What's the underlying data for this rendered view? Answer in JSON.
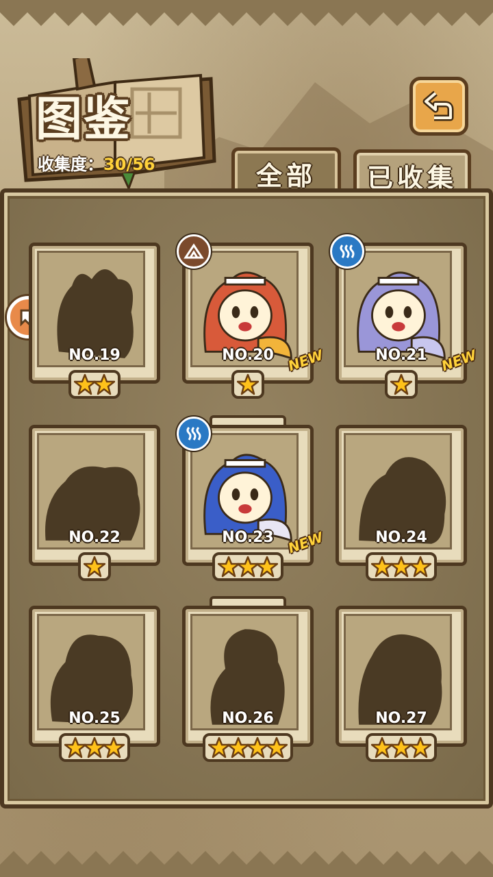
{
  "header": {
    "title": "图鉴",
    "collection_label": "收集度：",
    "collection_value": "30/56"
  },
  "tabs": [
    {
      "label": "全部",
      "active": true
    },
    {
      "label": "已收集",
      "active": false
    }
  ],
  "icons": {
    "back": "back-arrow-icon",
    "prev_page": "left-arrow-icon",
    "star": "star-icon",
    "earth": "mountain-element-icon",
    "water": "steam-element-icon"
  },
  "colors": {
    "star": "#ffc21a",
    "new_badge": "#ffd23a",
    "earth_element": "#7b4a2c",
    "water_element": "#2a79c4"
  },
  "cards": [
    {
      "number": "NO.19",
      "stars": 2,
      "unlocked": false,
      "new": false,
      "element": null
    },
    {
      "number": "NO.20",
      "stars": 1,
      "unlocked": true,
      "new": true,
      "new_label": "NEW",
      "element": "earth"
    },
    {
      "number": "NO.21",
      "stars": 1,
      "unlocked": true,
      "new": true,
      "new_label": "NEW",
      "element": "water"
    },
    {
      "number": "NO.22",
      "stars": 1,
      "unlocked": false,
      "new": false,
      "element": null
    },
    {
      "number": "NO.23",
      "stars": 3,
      "unlocked": true,
      "new": true,
      "new_label": "NEW",
      "element": "water"
    },
    {
      "number": "NO.24",
      "stars": 3,
      "unlocked": false,
      "new": false,
      "element": null
    },
    {
      "number": "NO.25",
      "stars": 3,
      "unlocked": false,
      "new": false,
      "element": null
    },
    {
      "number": "NO.26",
      "stars": 4,
      "unlocked": false,
      "new": false,
      "element": null
    },
    {
      "number": "NO.27",
      "stars": 3,
      "unlocked": false,
      "new": false,
      "element": null
    }
  ]
}
